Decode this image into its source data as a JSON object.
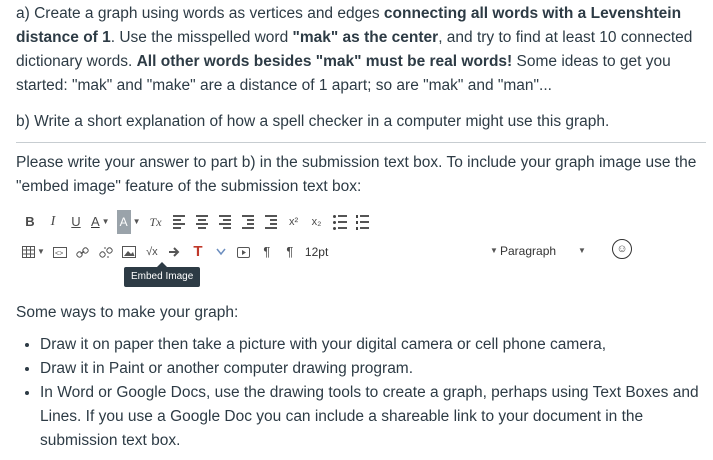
{
  "part_a": {
    "t1": "a) Create a graph using words as vertices and edges ",
    "t2": "connecting all words with a Levenshtein distance of 1",
    "t3": ". Use the misspelled word ",
    "t4": "\"mak\" as the center",
    "t5": ", and try to find at least 10 connected dictionary words. ",
    "t6": "All other words besides \"mak\" must be real words!",
    "t7": " Some ideas to get you started: \"mak\" and \"make\" are a distance of 1 apart; so are \"mak\" and \"man\"..."
  },
  "part_b": "b) Write a short explanation of how a spell checker in a computer might use this graph.",
  "instructions": "Please write your answer to part b) in the submission text box. To include your graph image use the \"embed image\" feature of the submission text box:",
  "toolbar": {
    "bold": "B",
    "italic": "I",
    "underline": "U",
    "font_color": "A",
    "background_color": "A",
    "clear_format": "Tx",
    "superscript": "x²",
    "subscript": "x₂",
    "sqrt": "√x",
    "text_color_t": "T",
    "pilcrow_ltr": "¶",
    "pilcrow_rtl": "¶",
    "font_size": "12pt",
    "block_format": "Paragraph",
    "a11y": "☺"
  },
  "tooltip": "Embed Image",
  "ways_title": "Some ways to make your graph:",
  "ways": [
    "Draw it on paper then take a picture with your digital camera or cell phone camera,",
    "Draw it in Paint or another computer drawing program.",
    "In Word or Google Docs, use the drawing tools to create a graph, perhaps using Text Boxes and Lines. If you use a Google Doc you can include a shareable link to your document in the submission text box."
  ],
  "colors": {
    "text": "#2d3b45",
    "tooltip_bg": "#2d3b45",
    "t_icon": "#c0392b",
    "divider": "#c7cdd1"
  }
}
